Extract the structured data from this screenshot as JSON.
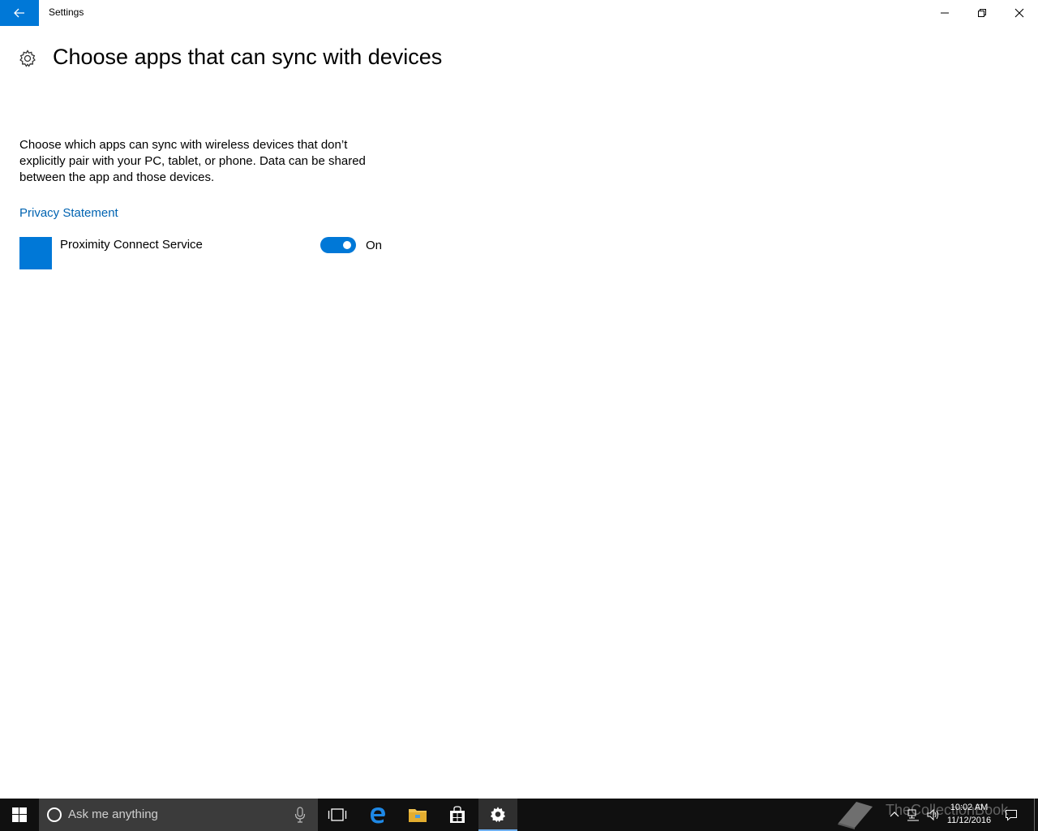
{
  "window": {
    "title": "Settings"
  },
  "page": {
    "title": "Choose apps that can sync with devices",
    "description": "Choose which apps can sync with wireless devices that don’t explicitly pair with your PC, tablet, or phone. Data can be shared between the app and those devices.",
    "privacy_link": "Privacy Statement"
  },
  "apps": [
    {
      "name": "Proximity Connect Service",
      "toggle_state": "On",
      "enabled": true
    }
  ],
  "taskbar": {
    "search_placeholder": "Ask me anything",
    "pinned": [
      "task-view",
      "edge",
      "file-explorer",
      "store",
      "settings"
    ],
    "active": "settings",
    "clock_time": "10:02 AM",
    "clock_date": "11/12/2016",
    "watermark": "TheCollectionBook"
  },
  "colors": {
    "accent": "#0078d7",
    "link": "#0063b1",
    "taskbar": "#101010"
  }
}
